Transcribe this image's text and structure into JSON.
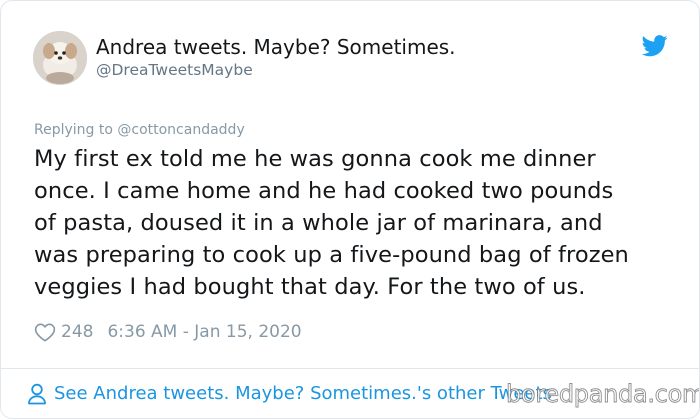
{
  "author": {
    "display_name": "Andrea tweets. Maybe? Sometimes.",
    "handle": "@DreaTweetsMaybe",
    "avatar_icon": "dog-avatar-photo"
  },
  "brand": {
    "icon": "twitter-bird-icon",
    "color": "#1da1f2"
  },
  "reply": {
    "label": "Replying to @cottoncandaddy"
  },
  "tweet": {
    "lines": [
      "My first ex told me he was gonna cook me dinner",
      "once. I came home and he had cooked two pounds",
      "of pasta, doused it in a whole jar of marinara, and",
      "was preparing to cook up a five-pound bag of frozen",
      "veggies I had bought that day. For the two of us."
    ]
  },
  "meta": {
    "likes": "248",
    "timestamp": "6:36 AM - Jan 15, 2020",
    "like_icon": "heart-icon"
  },
  "footer": {
    "link_label": "See Andrea tweets. Maybe? Sometimes.'s other Tweets",
    "link_icon": "person-icon",
    "link_color": "#1b95e0"
  },
  "watermark": {
    "text": "boredpanda.com"
  }
}
